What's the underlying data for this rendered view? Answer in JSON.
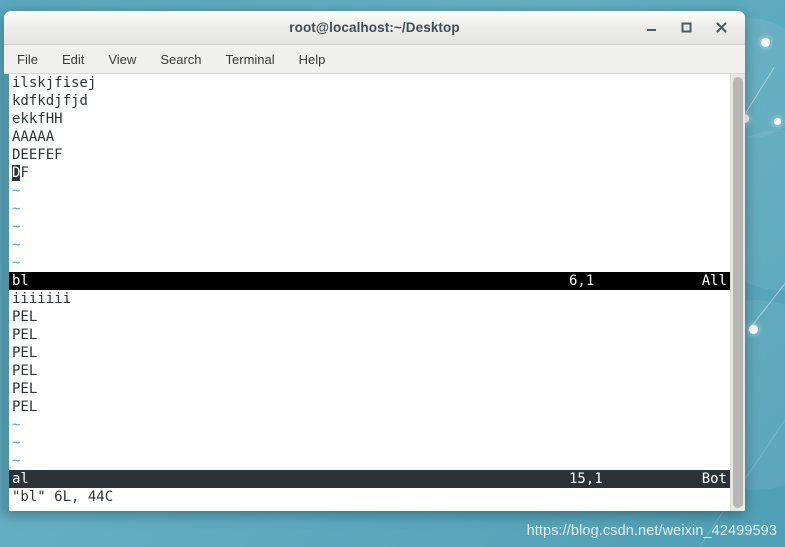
{
  "desktop": {
    "watermark": "https://blog.csdn.net/weixin_42499593",
    "background_color": "#5aa8bd"
  },
  "window": {
    "title": "root@localhost:~/Desktop",
    "controls": {
      "minimize": "minimize",
      "maximize": "maximize",
      "close": "close"
    }
  },
  "menubar": {
    "items": [
      {
        "label": "File"
      },
      {
        "label": "Edit"
      },
      {
        "label": "View"
      },
      {
        "label": "Search"
      },
      {
        "label": "Terminal"
      },
      {
        "label": "Help"
      }
    ]
  },
  "terminal": {
    "top_window": {
      "lines": [
        "ilskjfisej",
        "kdfkdjfjd",
        "ekkfHH",
        "AAAAA",
        "DEEFEF"
      ],
      "cursor_line": {
        "cursor_char": "D",
        "rest": "F"
      },
      "tildes": [
        "~",
        "~",
        "~",
        "~",
        "~"
      ],
      "status": {
        "name": "bl",
        "position": "6,1",
        "scroll": "All",
        "state": "active",
        "bg": "#000000"
      }
    },
    "bottom_window": {
      "lines": [
        "iiiiiii",
        "PEL",
        "PEL",
        "PEL",
        "PEL",
        "PEL",
        "PEL"
      ],
      "tildes": [
        "~",
        "~",
        "~"
      ],
      "status": {
        "name": "al",
        "position": "15,1",
        "scroll": "Bot",
        "state": "inactive",
        "bg": "#2b3338"
      }
    },
    "command_line": "\"bl\" 6L, 44C"
  }
}
